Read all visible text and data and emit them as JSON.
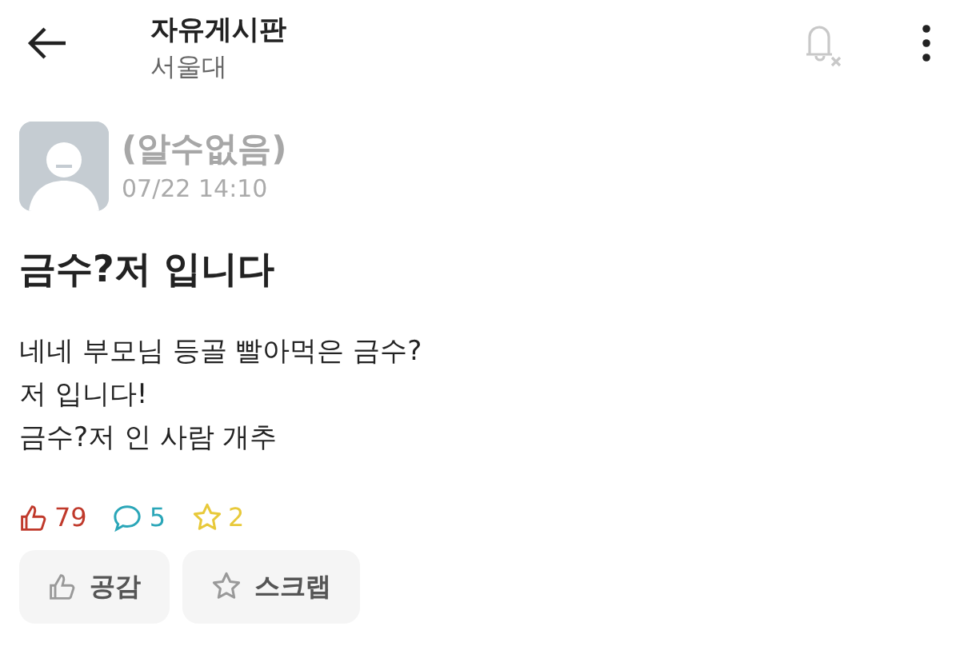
{
  "header": {
    "title": "자유게시판",
    "subtitle": "서울대"
  },
  "post": {
    "author": "(알수없음)",
    "time": "07/22 14:10",
    "title": "금수?저 입니다",
    "body": [
      "네네 부모님 등골 빨아먹은 금수?",
      "저 입니다!",
      "금수?저 인 사람 개추"
    ],
    "stats": [
      {
        "kind": "likes",
        "count": "79",
        "color": "#c0392b"
      },
      {
        "kind": "comments",
        "count": "5",
        "color": "#2aa6b8"
      },
      {
        "kind": "scraps",
        "count": "2",
        "color": "#e8c93a"
      }
    ],
    "actions": [
      {
        "kind": "like",
        "label": "공감"
      },
      {
        "kind": "scrap",
        "label": "스크랩"
      }
    ]
  }
}
